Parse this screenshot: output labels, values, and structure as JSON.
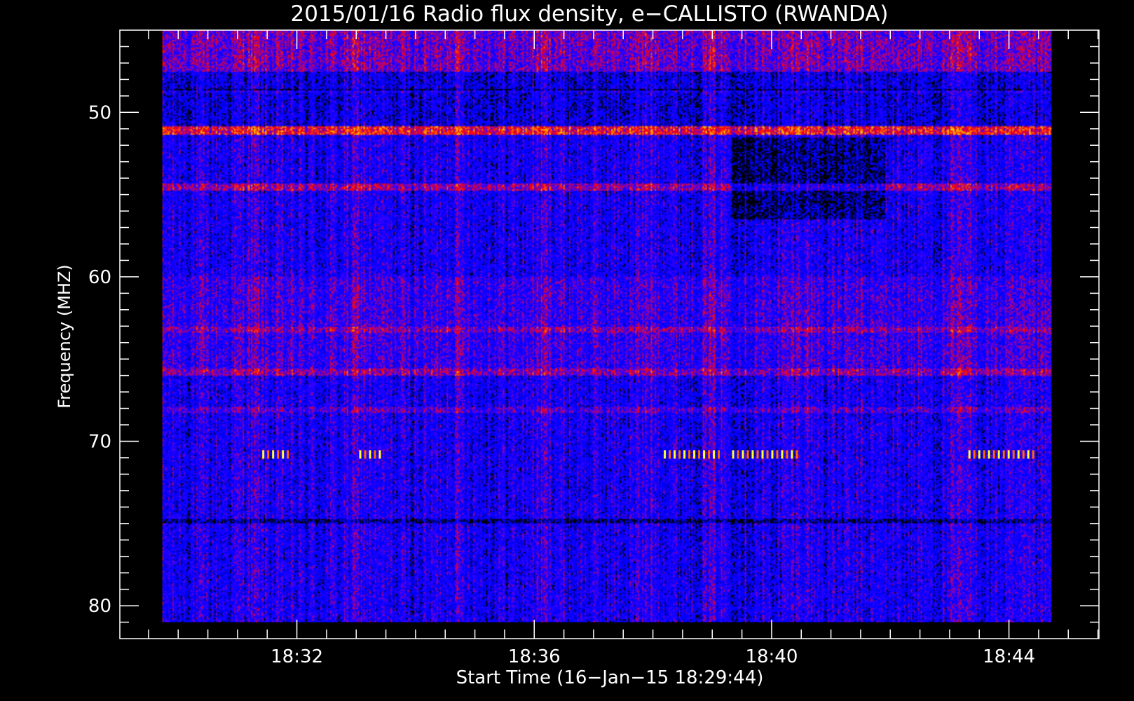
{
  "chart_data": {
    "type": "heatmap",
    "title": "2015/01/16  Radio flux density, e−CALLISTO (RWANDA)",
    "xlabel": "Start Time (16−Jan−15 18:29:44)",
    "ylabel": "Frequency (MHZ)",
    "y_axis": {
      "range": [
        45,
        82
      ],
      "reversed": true,
      "major_ticks": [
        50,
        60,
        70,
        80
      ],
      "tick_labels": [
        "50",
        "60",
        "70",
        "80"
      ]
    },
    "x_axis": {
      "range": [
        "18:29:01",
        "18:45:31"
      ],
      "major_ticks": [
        "18:32",
        "18:36",
        "18:40",
        "18:44"
      ],
      "tick_labels": [
        "18:32",
        "18:36",
        "18:40",
        "18:44"
      ]
    },
    "data_extent": {
      "time": [
        "18:29:44",
        "18:44:43"
      ],
      "frequency_mhz": [
        45.0,
        81.0
      ]
    },
    "grid": false,
    "colormap": [
      "#000000",
      "#0000ff",
      "#ff0000",
      "#ffff00"
    ],
    "background": "#000000",
    "strong_emission": [
      {
        "freq_mhz": 70.8,
        "time_start": "18:31:25",
        "time_end": "18:31:52"
      },
      {
        "freq_mhz": 70.8,
        "time_start": "18:33:03",
        "time_end": "18:33:23"
      },
      {
        "freq_mhz": 70.8,
        "time_start": "18:38:11",
        "time_end": "18:39:06"
      },
      {
        "freq_mhz": 70.8,
        "time_start": "18:39:20",
        "time_end": "18:40:27"
      },
      {
        "freq_mhz": 70.8,
        "time_start": "18:43:19",
        "time_end": "18:44:27"
      }
    ],
    "quiet_regions": [
      {
        "freq_mhz": [
          51.5,
          56.5
        ],
        "time_start": "18:39:20",
        "time_end": "18:41:55"
      }
    ]
  }
}
